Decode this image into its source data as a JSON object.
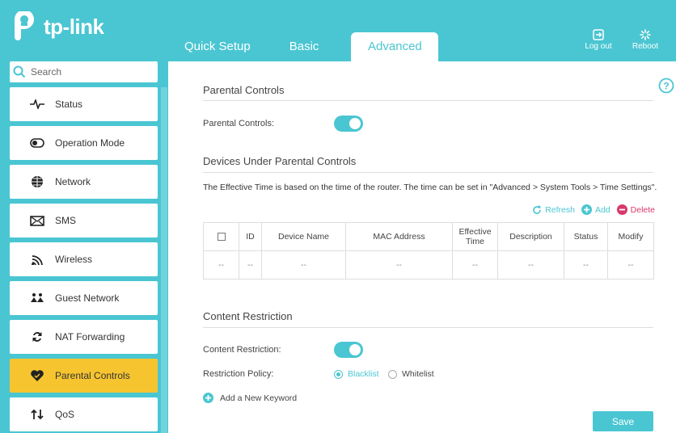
{
  "brand": {
    "name": "tp-link"
  },
  "tabs": [
    {
      "label": "Quick Setup"
    },
    {
      "label": "Basic"
    },
    {
      "label": "Advanced"
    }
  ],
  "header_buttons": {
    "logout": "Log out",
    "reboot": "Reboot"
  },
  "search": {
    "placeholder": "Search"
  },
  "sidebar": {
    "items": [
      {
        "label": "Status",
        "icon": "pulse-icon"
      },
      {
        "label": "Operation Mode",
        "icon": "toggle-icon"
      },
      {
        "label": "Network",
        "icon": "globe-icon"
      },
      {
        "label": "SMS",
        "icon": "envelope-icon"
      },
      {
        "label": "Wireless",
        "icon": "wifi-icon"
      },
      {
        "label": "Guest Network",
        "icon": "guest-icon"
      },
      {
        "label": "NAT Forwarding",
        "icon": "nat-icon"
      },
      {
        "label": "Parental Controls",
        "icon": "heart-icon",
        "active": true
      },
      {
        "label": "QoS",
        "icon": "qos-arrows-icon"
      }
    ]
  },
  "main": {
    "parental": {
      "title": "Parental Controls",
      "toggle_label": "Parental Controls:",
      "enabled": true
    },
    "devices": {
      "title": "Devices Under Parental Controls",
      "note": "The Effective Time is based on the time of the router. The time can be set in \"Advanced > System Tools > Time Settings\".",
      "actions": {
        "refresh": "Refresh",
        "add": "Add",
        "delete": "Delete"
      },
      "columns": [
        "ID",
        "Device Name",
        "MAC Address",
        "Effective Time",
        "Description",
        "Status",
        "Modify"
      ],
      "row": [
        "--",
        "--",
        "--",
        "--",
        "--",
        "--",
        "--",
        "--"
      ]
    },
    "content": {
      "title": "Content Restriction",
      "toggle_label": "Content Restriction:",
      "enabled": true,
      "policy_label": "Restriction Policy:",
      "policy_options": [
        "Blacklist",
        "Whitelist"
      ],
      "policy_selected": "Blacklist",
      "add_keyword": "Add a New Keyword"
    },
    "save": "Save"
  },
  "colors": {
    "accent": "#4ac6d2",
    "active_nav": "#f6c42f",
    "delete": "#d63a6a"
  }
}
